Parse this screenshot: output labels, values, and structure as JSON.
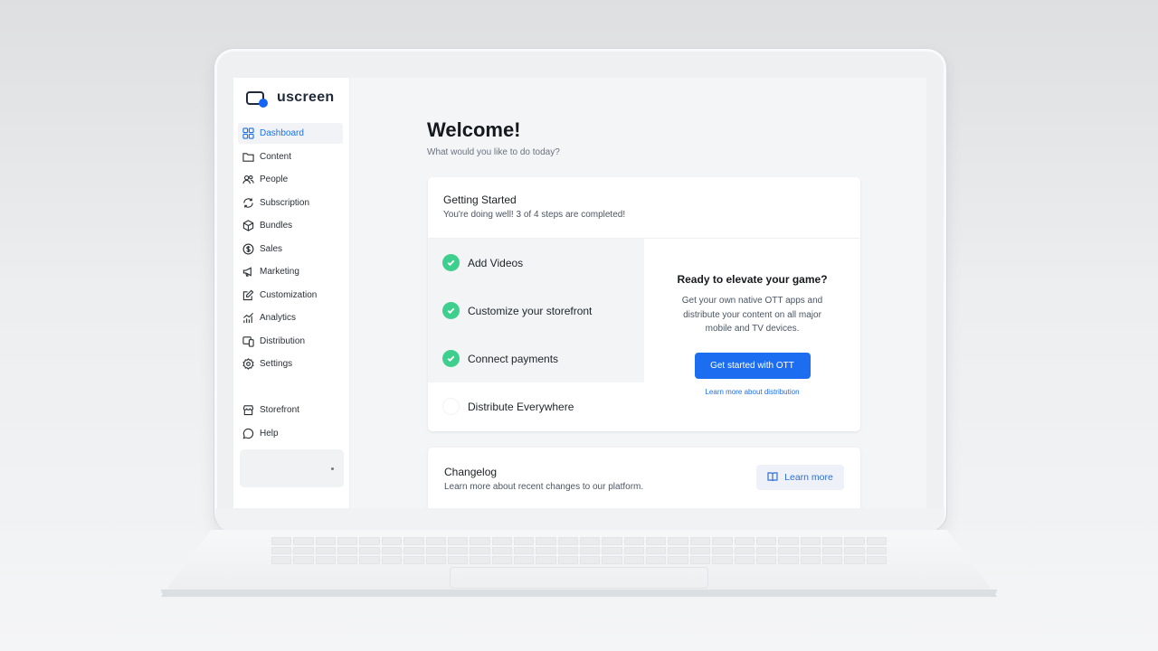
{
  "brand": {
    "name": "uscreen",
    "accent": "#1c6df0",
    "success": "#3ecf8e"
  },
  "sidebar": {
    "items": [
      {
        "label": "Dashboard",
        "icon": "grid-icon",
        "active": true
      },
      {
        "label": "Content",
        "icon": "folder-icon"
      },
      {
        "label": "People",
        "icon": "people-icon"
      },
      {
        "label": "Subscription",
        "icon": "refresh-icon"
      },
      {
        "label": "Bundles",
        "icon": "box-icon"
      },
      {
        "label": "Sales",
        "icon": "dollar-icon"
      },
      {
        "label": "Marketing",
        "icon": "megaphone-icon"
      },
      {
        "label": "Customization",
        "icon": "edit-icon"
      },
      {
        "label": "Analytics",
        "icon": "chart-icon"
      },
      {
        "label": "Distribution",
        "icon": "devices-icon"
      },
      {
        "label": "Settings",
        "icon": "gear-icon"
      }
    ],
    "secondary": [
      {
        "label": "Storefront",
        "icon": "store-icon"
      },
      {
        "label": "Help",
        "icon": "chat-icon"
      }
    ]
  },
  "main": {
    "title": "Welcome!",
    "subtitle": "What would you like to do today?"
  },
  "getting_started": {
    "title": "Getting Started",
    "progress": "You're doing well! 3 of 4 steps are completed!",
    "steps": [
      {
        "label": "Add Videos",
        "done": true
      },
      {
        "label": "Customize your storefront",
        "done": true
      },
      {
        "label": "Connect payments",
        "done": true
      },
      {
        "label": "Distribute Everywhere",
        "done": false
      }
    ]
  },
  "ott": {
    "title": "Ready to elevate your game?",
    "description": "Get your own native OTT apps and distribute your content on all major mobile and TV devices.",
    "button": "Get started with OTT",
    "link": "Learn more about distribution"
  },
  "changelog": {
    "title": "Changelog",
    "description": "Learn more about recent changes to our platform.",
    "button": "Learn more",
    "icon": "book-icon"
  }
}
